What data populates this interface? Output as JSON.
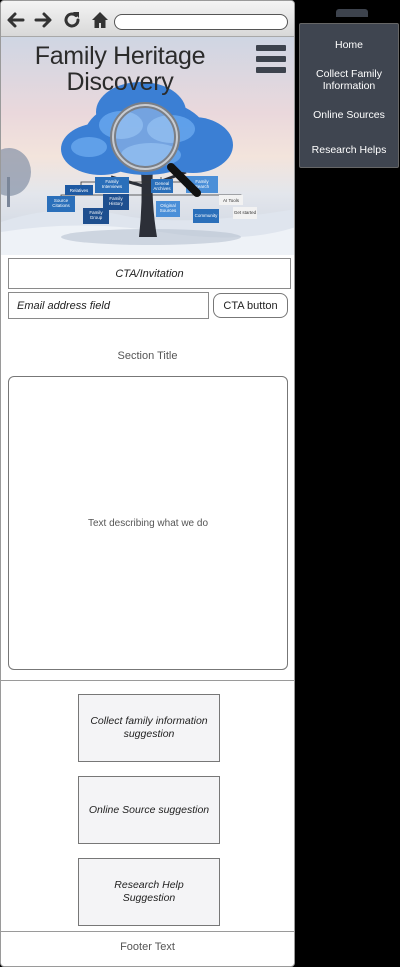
{
  "browser": {
    "url_value": ""
  },
  "header": {
    "title_line1": "Family Heritage",
    "title_line2": "Discovery"
  },
  "hero": {
    "tree_labels": [
      "Family Interviews",
      "Geneal Archives",
      "Family Search",
      "Relatives",
      "Family History Societies",
      "Source Citations",
      "AI Tools",
      "Original Sources",
      "Community Records",
      "Family Group Sheets",
      "Get started now"
    ]
  },
  "cta": {
    "invitation": "CTA/Invitation",
    "email_placeholder": "Email address field",
    "button_label": "CTA button"
  },
  "section": {
    "title": "Section Title",
    "description": "Text describing what we do"
  },
  "suggestions": [
    "Collect family information suggestion",
    "Online Source suggestion",
    "Research Help Suggestion"
  ],
  "footer": {
    "text": "Footer Text"
  },
  "nav": {
    "items": [
      "Home",
      "Collect Family Information",
      "Online Sources",
      "Research Helps"
    ]
  },
  "colors": {
    "nav_bg": "#3f4550",
    "accent_blue": "#4a8fd8",
    "frame": "#9a9a9a"
  }
}
